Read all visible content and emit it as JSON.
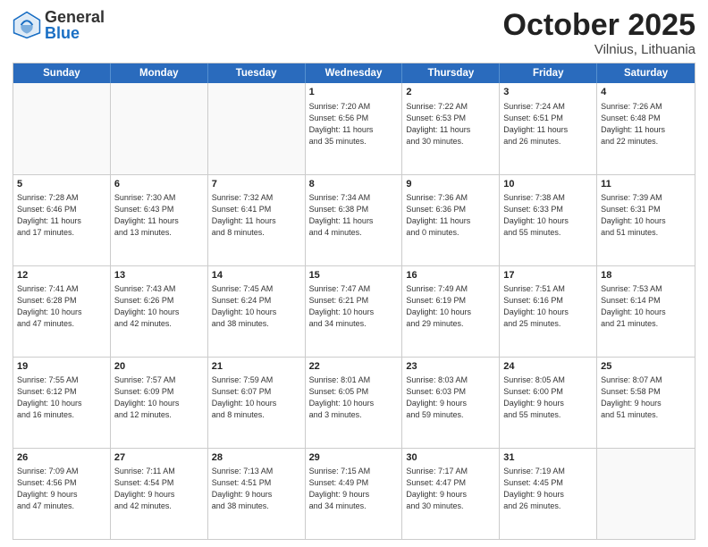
{
  "header": {
    "logo_general": "General",
    "logo_blue": "Blue",
    "month_title": "October 2025",
    "location": "Vilnius, Lithuania"
  },
  "days_of_week": [
    "Sunday",
    "Monday",
    "Tuesday",
    "Wednesday",
    "Thursday",
    "Friday",
    "Saturday"
  ],
  "weeks": [
    [
      {
        "day": "",
        "info": ""
      },
      {
        "day": "",
        "info": ""
      },
      {
        "day": "",
        "info": ""
      },
      {
        "day": "1",
        "info": "Sunrise: 7:20 AM\nSunset: 6:56 PM\nDaylight: 11 hours\nand 35 minutes."
      },
      {
        "day": "2",
        "info": "Sunrise: 7:22 AM\nSunset: 6:53 PM\nDaylight: 11 hours\nand 30 minutes."
      },
      {
        "day": "3",
        "info": "Sunrise: 7:24 AM\nSunset: 6:51 PM\nDaylight: 11 hours\nand 26 minutes."
      },
      {
        "day": "4",
        "info": "Sunrise: 7:26 AM\nSunset: 6:48 PM\nDaylight: 11 hours\nand 22 minutes."
      }
    ],
    [
      {
        "day": "5",
        "info": "Sunrise: 7:28 AM\nSunset: 6:46 PM\nDaylight: 11 hours\nand 17 minutes."
      },
      {
        "day": "6",
        "info": "Sunrise: 7:30 AM\nSunset: 6:43 PM\nDaylight: 11 hours\nand 13 minutes."
      },
      {
        "day": "7",
        "info": "Sunrise: 7:32 AM\nSunset: 6:41 PM\nDaylight: 11 hours\nand 8 minutes."
      },
      {
        "day": "8",
        "info": "Sunrise: 7:34 AM\nSunset: 6:38 PM\nDaylight: 11 hours\nand 4 minutes."
      },
      {
        "day": "9",
        "info": "Sunrise: 7:36 AM\nSunset: 6:36 PM\nDaylight: 11 hours\nand 0 minutes."
      },
      {
        "day": "10",
        "info": "Sunrise: 7:38 AM\nSunset: 6:33 PM\nDaylight: 10 hours\nand 55 minutes."
      },
      {
        "day": "11",
        "info": "Sunrise: 7:39 AM\nSunset: 6:31 PM\nDaylight: 10 hours\nand 51 minutes."
      }
    ],
    [
      {
        "day": "12",
        "info": "Sunrise: 7:41 AM\nSunset: 6:28 PM\nDaylight: 10 hours\nand 47 minutes."
      },
      {
        "day": "13",
        "info": "Sunrise: 7:43 AM\nSunset: 6:26 PM\nDaylight: 10 hours\nand 42 minutes."
      },
      {
        "day": "14",
        "info": "Sunrise: 7:45 AM\nSunset: 6:24 PM\nDaylight: 10 hours\nand 38 minutes."
      },
      {
        "day": "15",
        "info": "Sunrise: 7:47 AM\nSunset: 6:21 PM\nDaylight: 10 hours\nand 34 minutes."
      },
      {
        "day": "16",
        "info": "Sunrise: 7:49 AM\nSunset: 6:19 PM\nDaylight: 10 hours\nand 29 minutes."
      },
      {
        "day": "17",
        "info": "Sunrise: 7:51 AM\nSunset: 6:16 PM\nDaylight: 10 hours\nand 25 minutes."
      },
      {
        "day": "18",
        "info": "Sunrise: 7:53 AM\nSunset: 6:14 PM\nDaylight: 10 hours\nand 21 minutes."
      }
    ],
    [
      {
        "day": "19",
        "info": "Sunrise: 7:55 AM\nSunset: 6:12 PM\nDaylight: 10 hours\nand 16 minutes."
      },
      {
        "day": "20",
        "info": "Sunrise: 7:57 AM\nSunset: 6:09 PM\nDaylight: 10 hours\nand 12 minutes."
      },
      {
        "day": "21",
        "info": "Sunrise: 7:59 AM\nSunset: 6:07 PM\nDaylight: 10 hours\nand 8 minutes."
      },
      {
        "day": "22",
        "info": "Sunrise: 8:01 AM\nSunset: 6:05 PM\nDaylight: 10 hours\nand 3 minutes."
      },
      {
        "day": "23",
        "info": "Sunrise: 8:03 AM\nSunset: 6:03 PM\nDaylight: 9 hours\nand 59 minutes."
      },
      {
        "day": "24",
        "info": "Sunrise: 8:05 AM\nSunset: 6:00 PM\nDaylight: 9 hours\nand 55 minutes."
      },
      {
        "day": "25",
        "info": "Sunrise: 8:07 AM\nSunset: 5:58 PM\nDaylight: 9 hours\nand 51 minutes."
      }
    ],
    [
      {
        "day": "26",
        "info": "Sunrise: 7:09 AM\nSunset: 4:56 PM\nDaylight: 9 hours\nand 47 minutes."
      },
      {
        "day": "27",
        "info": "Sunrise: 7:11 AM\nSunset: 4:54 PM\nDaylight: 9 hours\nand 42 minutes."
      },
      {
        "day": "28",
        "info": "Sunrise: 7:13 AM\nSunset: 4:51 PM\nDaylight: 9 hours\nand 38 minutes."
      },
      {
        "day": "29",
        "info": "Sunrise: 7:15 AM\nSunset: 4:49 PM\nDaylight: 9 hours\nand 34 minutes."
      },
      {
        "day": "30",
        "info": "Sunrise: 7:17 AM\nSunset: 4:47 PM\nDaylight: 9 hours\nand 30 minutes."
      },
      {
        "day": "31",
        "info": "Sunrise: 7:19 AM\nSunset: 4:45 PM\nDaylight: 9 hours\nand 26 minutes."
      },
      {
        "day": "",
        "info": ""
      }
    ]
  ]
}
